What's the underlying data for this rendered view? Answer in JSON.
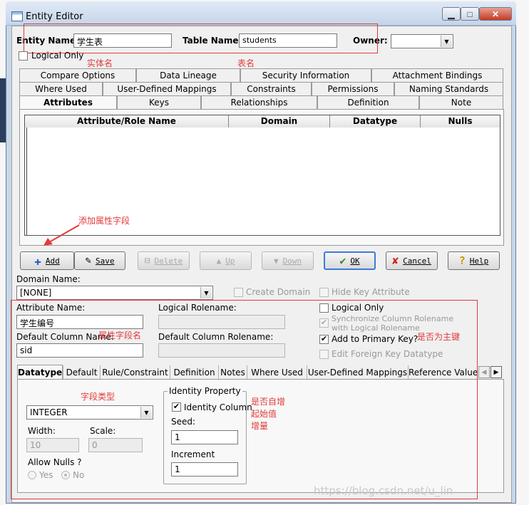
{
  "window": {
    "title": "Entity Editor"
  },
  "header": {
    "entity_name_label": "Entity Name:",
    "entity_name_value": "学生表",
    "table_name_label": "Table Name:",
    "table_name_value": "students",
    "owner_label": "Owner:",
    "owner_value": "",
    "logical_only_label": "Logical Only"
  },
  "annotations": {
    "entity_name": "实体名",
    "table_name": "表名",
    "add_attribute": "添加属性字段",
    "attribute_name": "属性字段名",
    "primary_key": "是否为主键",
    "datatype": "字段类型",
    "identity": [
      "是否自增",
      "起始值",
      "增量"
    ]
  },
  "tabs_row1": [
    "Compare Options",
    "Data Lineage",
    "Security Information",
    "Attachment Bindings"
  ],
  "tabs_row2": [
    "Where Used",
    "User-Defined Mappings",
    "Constraints",
    "Permissions",
    "Naming Standards"
  ],
  "tabs_row3": [
    "Attributes",
    "Keys",
    "Relationships",
    "Definition",
    "Note"
  ],
  "grid": {
    "columns": [
      "Attribute/Role Name",
      "Domain",
      "Datatype",
      "Nulls"
    ]
  },
  "buttons": {
    "add": "Add",
    "save": "Save",
    "delete": "Delete",
    "up": "Up",
    "down": "Down",
    "ok": "OK",
    "cancel": "Cancel",
    "help": "Help"
  },
  "domain": {
    "label": "Domain Name:",
    "value": "[NONE]",
    "create_domain": "Create Domain",
    "hide_key": "Hide Key Attribute"
  },
  "attribute": {
    "name_label": "Attribute Name:",
    "name_value": "学生编号",
    "column_label": "Default Column Name:",
    "column_value": "sid",
    "logical_rolename_label": "Logical Rolename:",
    "default_column_rolename_label": "Default Column Rolename:",
    "logical_only": "Logical Only",
    "sync_line1": "Synchronize Column Rolename",
    "sync_line2": "with Logical Rolename",
    "add_pk": "Add to Primary Key?",
    "edit_fk": "Edit Foreign Key Datatype"
  },
  "bottom_tabs": [
    "Datatype",
    "Default",
    "Rule/Constraint",
    "Definition",
    "Notes",
    "Where Used",
    "User-Defined Mappings",
    "Reference Value"
  ],
  "datatype": {
    "type_value": "INTEGER",
    "width_label": "Width:",
    "width_value": "10",
    "scale_label": "Scale:",
    "scale_value": "0",
    "allow_nulls_label": "Allow Nulls ?",
    "yes_label": "Yes",
    "no_label": "No"
  },
  "identity": {
    "group_label": "Identity Property",
    "column_label": "Identity Column",
    "seed_label": "Seed:",
    "seed_value": "1",
    "increment_label": "Increment",
    "increment_value": "1"
  },
  "watermark": "https://blog.csdn.net/u_lin"
}
